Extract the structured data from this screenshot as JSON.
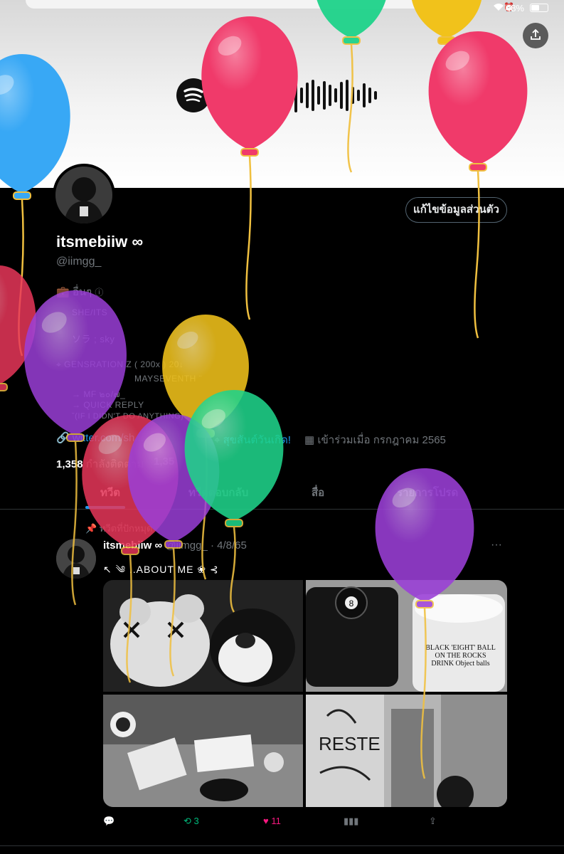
{
  "status_bar": {
    "battery": "48%"
  },
  "header": {
    "upload_icon": "upload-icon",
    "banner_art": "spotify-code"
  },
  "profile": {
    "edit_button": "แก้ไขข้อมูลส่วนตัว",
    "display_name": "itsmebiiw ∞",
    "handle": "@iimgg_",
    "category": "อื่นๆ",
    "bio_lines": [
      "SHE/ITS",
      "ソラ ; sky",
      "GENSRATION Z ( 200x ) 20↓",
      "MAYSEVENTH ¨",
      "→ MF ๒๐/๗_",
      "→ QUICK REPLY",
      "ˇ(IF I DIDN'T DO ANYTHING)"
    ],
    "website": "witter.com/sh...",
    "birthday": "สุขสันต์วันเกิด!",
    "joined": "เข้าร่วมเมื่อ กรกฎาคม 2565",
    "following_count": "1,358",
    "following_label": "กำลังติดตาม",
    "followers_count": "1,35"
  },
  "tabs": [
    "ทวีต",
    "ทวีตตอบกลับ",
    "สื่อ",
    "รายการโปรด"
  ],
  "pinned": {
    "label": "ทวีตที่ปักหมุด",
    "name": "itsmebiiw ∞",
    "handle": "@iimgg_",
    "date": "· 4/8/65",
    "text": "↖ ༄ ..ABOUT ME ❀ ⊰",
    "photo_text": {
      "ball": "8",
      "candle_label": "BLACK 'EIGHT' BALL ON THE ROCKS DRINK Object balls",
      "graffiti": "RESTE"
    },
    "actions": {
      "reply": "",
      "retweets": "3",
      "likes": "11",
      "views": "",
      "share": ""
    }
  },
  "colors": {
    "accent": "#1d9bf0",
    "retweet": "#00ba7c",
    "like": "#f91880",
    "balloon_pink": "#f03a6a",
    "balloon_blue": "#38a8f5",
    "balloon_green": "#1fd38a",
    "balloon_purple": "#9b3fd8",
    "balloon_yellow": "#f1c21b",
    "balloon_red": "#e8375a"
  }
}
